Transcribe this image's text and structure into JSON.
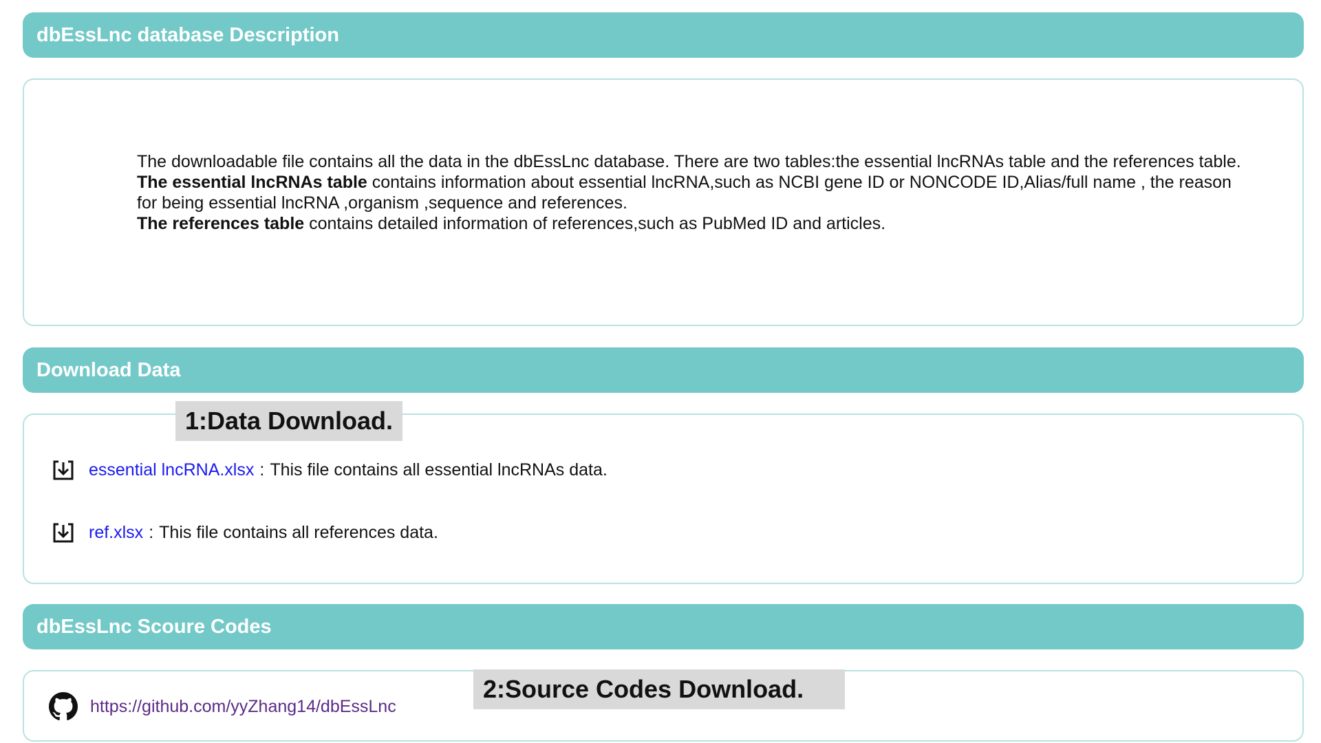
{
  "description": {
    "header": "dbEssLnc database Description",
    "para1": "The downloadable file contains all the data in the dbEssLnc database. There are two tables:the essential lncRNAs table and the references table.",
    "para2_bold": "The essential lncRNAs table",
    "para2_rest": " contains information about essential lncRNA,such as NCBI gene ID or NONCODE ID,Alias/full name , the reason for being essential lncRNA ,organism ,sequence and references.",
    "para3_bold": "The references table",
    "para3_rest": " contains detailed information of references,such as PubMed ID and articles."
  },
  "download": {
    "header": "Download Data",
    "annotation": "1:Data Download.",
    "files": [
      {
        "link": "essential lncRNA.xlsx",
        "sep": ":",
        "desc": "This file contains all essential lncRNAs data."
      },
      {
        "link": "ref.xlsx",
        "sep": ":",
        "desc": "This file contains all references data."
      }
    ]
  },
  "source": {
    "header": "dbEssLnc Scoure Codes",
    "annotation": "2:Source Codes Download.",
    "link": "https://github.com/yyZhang14/dbEssLnc"
  },
  "icons": {
    "download": "download-icon",
    "github": "github-icon"
  },
  "colors": {
    "header_bg": "#73c9c8",
    "panel_border": "#b6e3e2",
    "link": "#1a1aee",
    "visited_link": "#5b2a86",
    "annotation_bg": "#d9d9d9"
  }
}
